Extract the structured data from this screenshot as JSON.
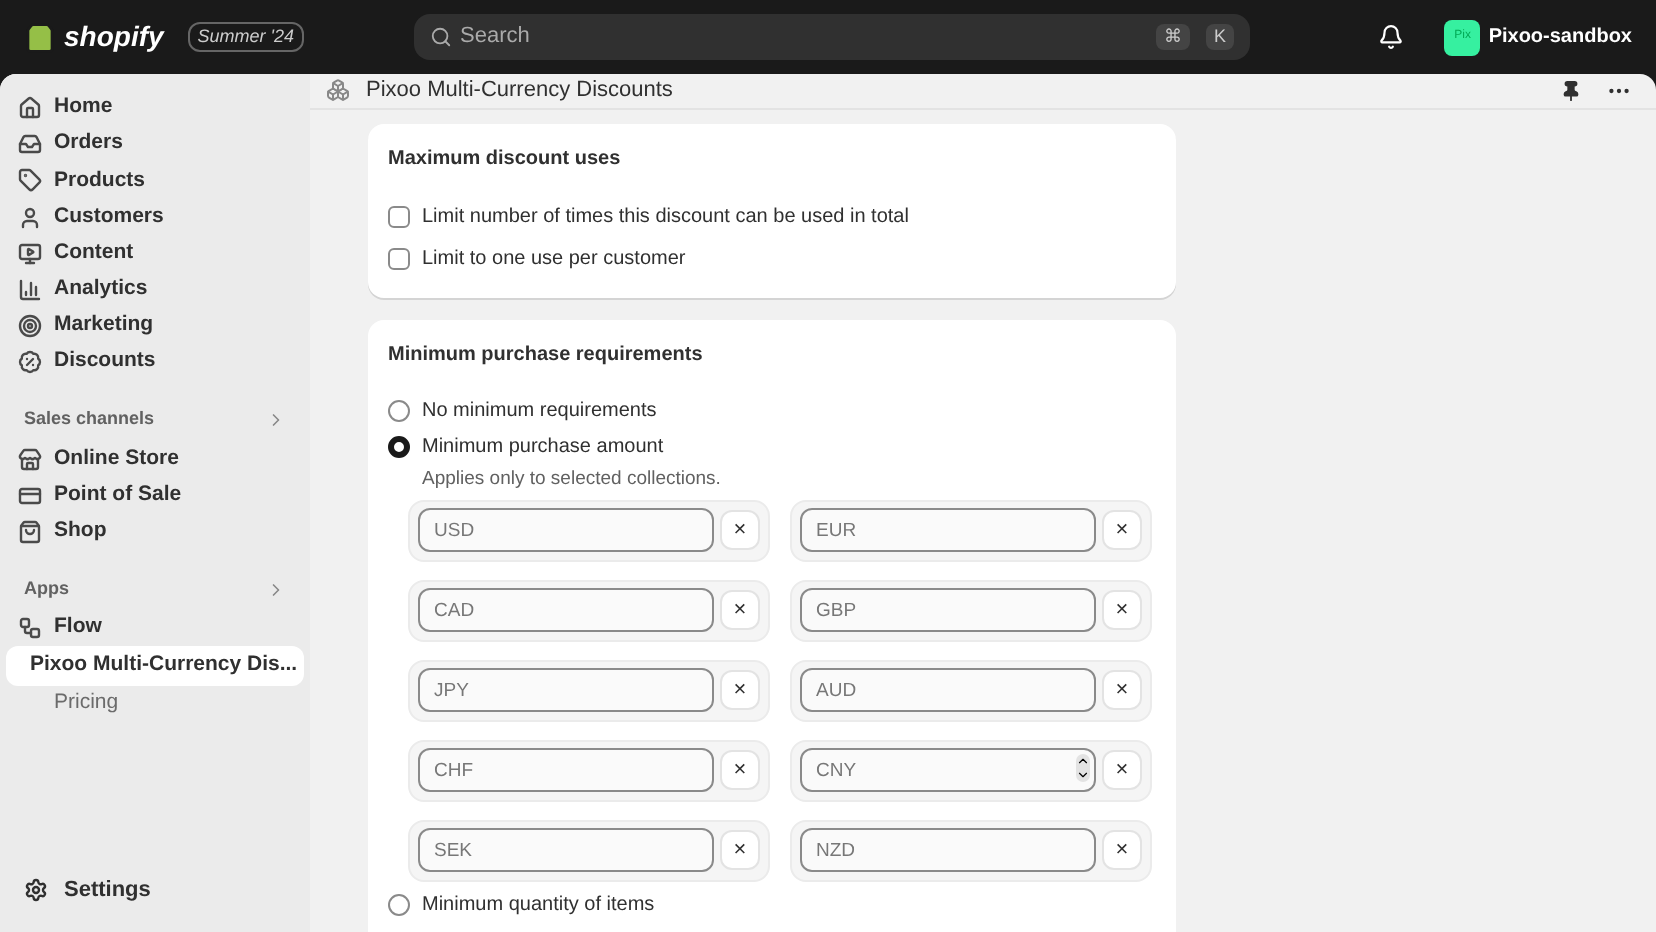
{
  "topbar": {
    "logo": "shopify",
    "edition_badge": "Summer '24",
    "search": {
      "placeholder": "Search",
      "shortcut": [
        "⌘",
        "K"
      ]
    },
    "store": {
      "avatar": "Pix",
      "name": "Pixoo-sandbox"
    }
  },
  "sidebar": {
    "items": [
      {
        "label": "Home",
        "selected": false
      },
      {
        "label": "Orders",
        "selected": false
      },
      {
        "label": "Products",
        "selected": false
      },
      {
        "label": "Customers",
        "selected": false
      },
      {
        "label": "Content",
        "selected": false
      },
      {
        "label": "Analytics",
        "selected": false
      },
      {
        "label": "Marketing",
        "selected": false
      },
      {
        "label": "Discounts",
        "selected": false
      }
    ],
    "sections": [
      {
        "title": "Sales channels",
        "items": [
          {
            "label": "Online Store",
            "kind": "link",
            "selected": false
          },
          {
            "label": "Point of Sale",
            "kind": "link",
            "selected": false
          },
          {
            "label": "Shop",
            "kind": "link",
            "selected": false
          }
        ]
      },
      {
        "title": "Apps",
        "items": [
          {
            "label": "Flow",
            "kind": "link",
            "selected": false
          },
          {
            "label": "Pixoo Multi-Currency Dis...",
            "kind": "link",
            "selected": true
          },
          {
            "label": "Pricing",
            "kind": "subpage",
            "selected": false
          }
        ]
      }
    ],
    "settings": "Settings"
  },
  "page": {
    "title": "Pixoo Multi-Currency Discounts",
    "max_uses": {
      "title": "Maximum discount uses",
      "options": [
        {
          "label": "Limit number of times this discount can be used in total",
          "checked": false
        },
        {
          "label": "Limit to one use per customer",
          "checked": false
        }
      ]
    },
    "min_requirements": {
      "title": "Minimum purchase requirements",
      "options": [
        {
          "label": "No minimum requirements",
          "selected": false
        },
        {
          "label": "Minimum purchase amount",
          "selected": true,
          "help": "Applies only to selected collections."
        },
        {
          "label": "Minimum quantity of items",
          "selected": false
        }
      ],
      "currencies": [
        {
          "placeholder": "USD",
          "spinner": false
        },
        {
          "placeholder": "EUR",
          "spinner": false
        },
        {
          "placeholder": "CAD",
          "spinner": false
        },
        {
          "placeholder": "GBP",
          "spinner": false
        },
        {
          "placeholder": "JPY",
          "spinner": false
        },
        {
          "placeholder": "AUD",
          "spinner": false
        },
        {
          "placeholder": "CHF",
          "spinner": false
        },
        {
          "placeholder": "CNY",
          "spinner": true
        },
        {
          "placeholder": "SEK",
          "spinner": false
        },
        {
          "placeholder": "NZD",
          "spinner": false
        }
      ],
      "remove_label": "×"
    }
  }
}
